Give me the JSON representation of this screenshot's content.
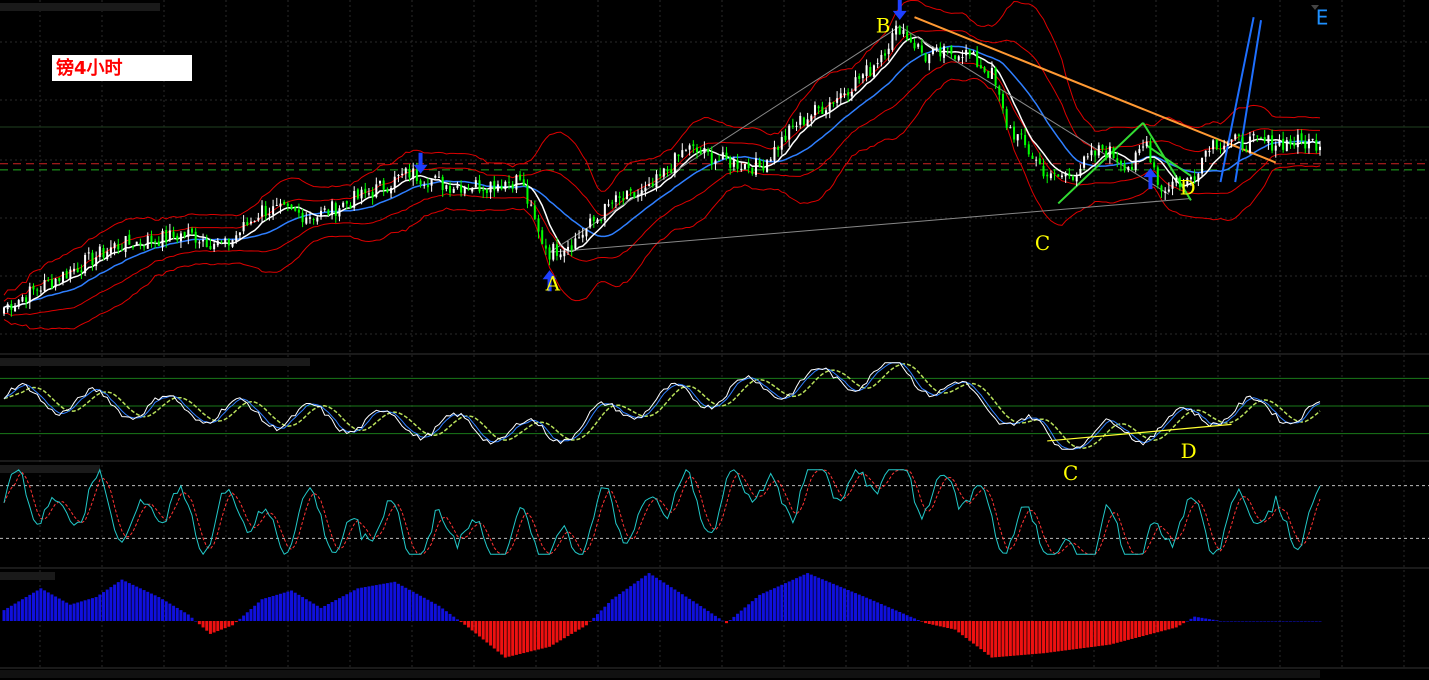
{
  "chart_label": "镑4小时",
  "colors": {
    "background": "#000000",
    "candle_up": "#ffffff",
    "candle_down": "#00ff00",
    "bollinger": "#dd0000",
    "ma_fast": "#ffffff",
    "ma_slow": "#2f7fff",
    "trend_down": "#ff9933",
    "trend_triangle": "#33dd33",
    "wave_label": "#ffff00",
    "macd_positive": "#1010dd",
    "macd_negative": "#ee1111"
  },
  "icons": {
    "top_arrow": "down-arrow-icon",
    "bottom_arrow": "up-arrow-icon",
    "top_right": "triangle-marker-icon"
  },
  "price_waves": [
    {
      "label": "A",
      "x": 148,
      "y": 1.281
    },
    {
      "label": "B",
      "x": 243,
      "y": 1.318
    },
    {
      "label": "C",
      "x": 284,
      "y": 1.286
    },
    {
      "label": "D",
      "x": 320,
      "y": 1.296
    },
    {
      "label": "E",
      "x": 345,
      "y": 1.318
    }
  ],
  "stoch_labels": [
    {
      "label": "C",
      "x": 290
    },
    {
      "label": "D",
      "x": 323
    }
  ],
  "chart_data": [
    {
      "type": "candlestick",
      "panel": "price",
      "x_range": [
        0,
        357
      ],
      "ylim": [
        1.265,
        1.321
      ],
      "reference_lines": {
        "red_dashed": 1.2955,
        "green_dashed": 1.2945
      },
      "close_anchors": [
        [
          0,
          1.272
        ],
        [
          30,
          1.282
        ],
        [
          50,
          1.284
        ],
        [
          60,
          1.282
        ],
        [
          70,
          1.288
        ],
        [
          85,
          1.287
        ],
        [
          100,
          1.291
        ],
        [
          110,
          1.294
        ],
        [
          120,
          1.292
        ],
        [
          130,
          1.292
        ],
        [
          140,
          1.293
        ],
        [
          145,
          1.284
        ],
        [
          148,
          1.281
        ],
        [
          155,
          1.283
        ],
        [
          165,
          1.289
        ],
        [
          175,
          1.291
        ],
        [
          185,
          1.298
        ],
        [
          195,
          1.296
        ],
        [
          205,
          1.295
        ],
        [
          215,
          1.302
        ],
        [
          225,
          1.306
        ],
        [
          235,
          1.311
        ],
        [
          243,
          1.318
        ],
        [
          250,
          1.313
        ],
        [
          260,
          1.314
        ],
        [
          268,
          1.31
        ],
        [
          272,
          1.302
        ],
        [
          280,
          1.296
        ],
        [
          284,
          1.293
        ],
        [
          290,
          1.294
        ],
        [
          298,
          1.298
        ],
        [
          306,
          1.295
        ],
        [
          310,
          1.299
        ],
        [
          314,
          1.291
        ],
        [
          318,
          1.293
        ],
        [
          320,
          1.292
        ],
        [
          323,
          1.294
        ],
        [
          327,
          1.299
        ]
      ],
      "markers": [
        {
          "x": 113,
          "type": "down-arrow-icon"
        },
        {
          "x": 148,
          "type": "up-arrow-icon"
        },
        {
          "x": 243,
          "type": "down-arrow-icon"
        },
        {
          "x": 311,
          "type": "up-arrow-icon"
        }
      ]
    },
    {
      "type": "line",
      "panel": "stochastic",
      "ylim": [
        0,
        100
      ],
      "levels": [
        80,
        50,
        20
      ],
      "x_range": [
        0,
        357
      ]
    },
    {
      "type": "line",
      "panel": "oscillator",
      "ylim": [
        0,
        100
      ],
      "levels": [
        80,
        20
      ],
      "x_range": [
        0,
        357
      ]
    },
    {
      "type": "bar",
      "panel": "macd_histogram",
      "x_range": [
        0,
        357
      ],
      "ylim": [
        -40,
        45
      ],
      "anchors": [
        [
          0,
          10
        ],
        [
          10,
          30
        ],
        [
          18,
          15
        ],
        [
          25,
          22
        ],
        [
          32,
          38
        ],
        [
          42,
          22
        ],
        [
          50,
          6
        ],
        [
          56,
          -12
        ],
        [
          62,
          -4
        ],
        [
          70,
          20
        ],
        [
          78,
          28
        ],
        [
          86,
          12
        ],
        [
          96,
          30
        ],
        [
          106,
          36
        ],
        [
          118,
          14
        ],
        [
          126,
          -6
        ],
        [
          136,
          -34
        ],
        [
          148,
          -24
        ],
        [
          158,
          -4
        ],
        [
          165,
          20
        ],
        [
          175,
          44
        ],
        [
          188,
          16
        ],
        [
          196,
          -2
        ],
        [
          205,
          24
        ],
        [
          218,
          44
        ],
        [
          235,
          20
        ],
        [
          250,
          -2
        ],
        [
          258,
          -8
        ],
        [
          268,
          -34
        ],
        [
          282,
          -30
        ],
        [
          300,
          -22
        ],
        [
          318,
          -6
        ],
        [
          323,
          4
        ],
        [
          330,
          0
        ]
      ]
    }
  ]
}
